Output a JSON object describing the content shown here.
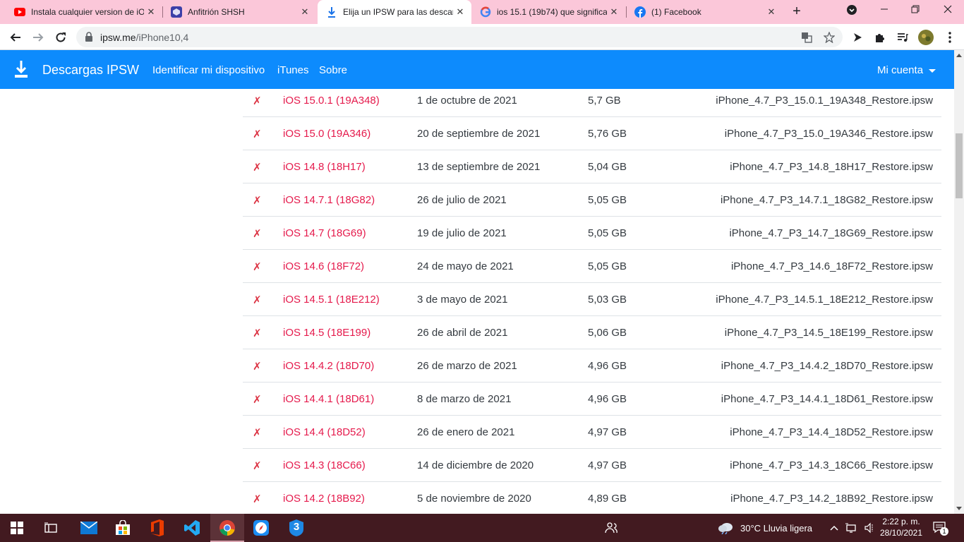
{
  "browser": {
    "tabs": [
      {
        "title": "Instala cualquier version de iOS",
        "favicon": "youtube-icon",
        "active": false
      },
      {
        "title": "Anfitrión SHSH",
        "favicon": "shsh-icon",
        "active": false
      },
      {
        "title": "Elija un IPSW para las descargas",
        "favicon": "download-icon",
        "active": true
      },
      {
        "title": "ios 15.1 (19b74) que significa",
        "favicon": "google-icon",
        "active": false
      },
      {
        "title": "(1) Facebook",
        "favicon": "facebook-icon",
        "active": false
      }
    ],
    "new_tab": "+",
    "url_domain": "ipsw.me",
    "url_path": "/iPhone10,4",
    "colors": {
      "tabstrip": "#fbc7d9",
      "navbar": "#0d8bfd",
      "link": "#e51a4c",
      "taskbar": "#421a20"
    }
  },
  "site": {
    "brand": "Descargas IPSW",
    "nav": [
      "Identificar mi dispositivo",
      "iTunes",
      "Sobre"
    ],
    "account": "Mi cuenta"
  },
  "firmwares": [
    {
      "mark": "✗",
      "version": "iOS 15.0.1 (19A348)",
      "date": "1 de octubre de 2021",
      "size": "5,7 GB",
      "file": "iPhone_4.7_P3_15.0.1_19A348_Restore.ipsw"
    },
    {
      "mark": "✗",
      "version": "iOS 15.0 (19A346)",
      "date": "20 de septiembre de 2021",
      "size": "5,76 GB",
      "file": "iPhone_4.7_P3_15.0_19A346_Restore.ipsw"
    },
    {
      "mark": "✗",
      "version": "iOS 14.8 (18H17)",
      "date": "13 de septiembre de 2021",
      "size": "5,04 GB",
      "file": "iPhone_4.7_P3_14.8_18H17_Restore.ipsw"
    },
    {
      "mark": "✗",
      "version": "iOS 14.7.1 (18G82)",
      "date": "26 de julio de 2021",
      "size": "5,05 GB",
      "file": "iPhone_4.7_P3_14.7.1_18G82_Restore.ipsw"
    },
    {
      "mark": "✗",
      "version": "iOS 14.7 (18G69)",
      "date": "19 de julio de 2021",
      "size": "5,05 GB",
      "file": "iPhone_4.7_P3_14.7_18G69_Restore.ipsw"
    },
    {
      "mark": "✗",
      "version": "iOS 14.6 (18F72)",
      "date": "24 de mayo de 2021",
      "size": "5,05 GB",
      "file": "iPhone_4.7_P3_14.6_18F72_Restore.ipsw"
    },
    {
      "mark": "✗",
      "version": "iOS 14.5.1 (18E212)",
      "date": "3 de mayo de 2021",
      "size": "5,03 GB",
      "file": "iPhone_4.7_P3_14.5.1_18E212_Restore.ipsw"
    },
    {
      "mark": "✗",
      "version": "iOS 14.5 (18E199)",
      "date": "26 de abril de 2021",
      "size": "5,06 GB",
      "file": "iPhone_4.7_P3_14.5_18E199_Restore.ipsw"
    },
    {
      "mark": "✗",
      "version": "iOS 14.4.2 (18D70)",
      "date": "26 de marzo de 2021",
      "size": "4,96 GB",
      "file": "iPhone_4.7_P3_14.4.2_18D70_Restore.ipsw"
    },
    {
      "mark": "✗",
      "version": "iOS 14.4.1 (18D61)",
      "date": "8 de marzo de 2021",
      "size": "4,96 GB",
      "file": "iPhone_4.7_P3_14.4.1_18D61_Restore.ipsw"
    },
    {
      "mark": "✗",
      "version": "iOS 14.4 (18D52)",
      "date": "26 de enero de 2021",
      "size": "4,97 GB",
      "file": "iPhone_4.7_P3_14.4_18D52_Restore.ipsw"
    },
    {
      "mark": "✗",
      "version": "iOS 14.3 (18C66)",
      "date": "14 de diciembre de 2020",
      "size": "4,97 GB",
      "file": "iPhone_4.7_P3_14.3_18C66_Restore.ipsw"
    },
    {
      "mark": "✗",
      "version": "iOS 14.2 (18B92)",
      "date": "5 de noviembre de 2020",
      "size": "4,89 GB",
      "file": "iPhone_4.7_P3_14.2_18B92_Restore.ipsw"
    }
  ],
  "taskbar": {
    "weather": "30°C  Lluvia ligera",
    "time": "2:22 p. m.",
    "date": "28/10/2021",
    "notifications": "1",
    "app_badge": "3"
  }
}
